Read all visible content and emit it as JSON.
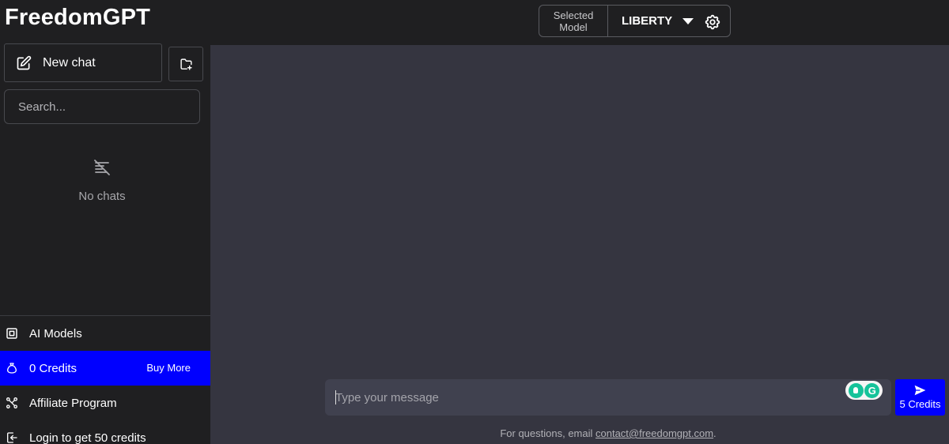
{
  "app": {
    "title": "FreedomGPT"
  },
  "header": {
    "model_caption_line1": "Selected",
    "model_caption_line2": "Model",
    "model_name": "LIBERTY",
    "icons": [
      "caret-down-icon",
      "gear-icon"
    ]
  },
  "sidebar": {
    "new_chat_label": "New chat",
    "search_placeholder": "Search...",
    "empty_state": "No chats",
    "menu": [
      {
        "label": "AI Models",
        "icon": "cube-icon"
      },
      {
        "label": "0 Credits",
        "icon": "money-bag-icon",
        "action": "Buy More"
      },
      {
        "label": "Affiliate Program",
        "icon": "share-nodes-icon"
      },
      {
        "label": "Login to get 50 credits",
        "icon": "login-icon"
      }
    ]
  },
  "composer": {
    "placeholder": "Type your message",
    "send_label": "5 Credits"
  },
  "footer": {
    "prefix": "For questions, email ",
    "email": "contact@freedomgpt.com",
    "suffix": "."
  },
  "colors": {
    "accent": "#0000ff",
    "sidebar_bg": "#1f1f21",
    "main_bg": "#353540",
    "composer_bg": "#40414f"
  }
}
